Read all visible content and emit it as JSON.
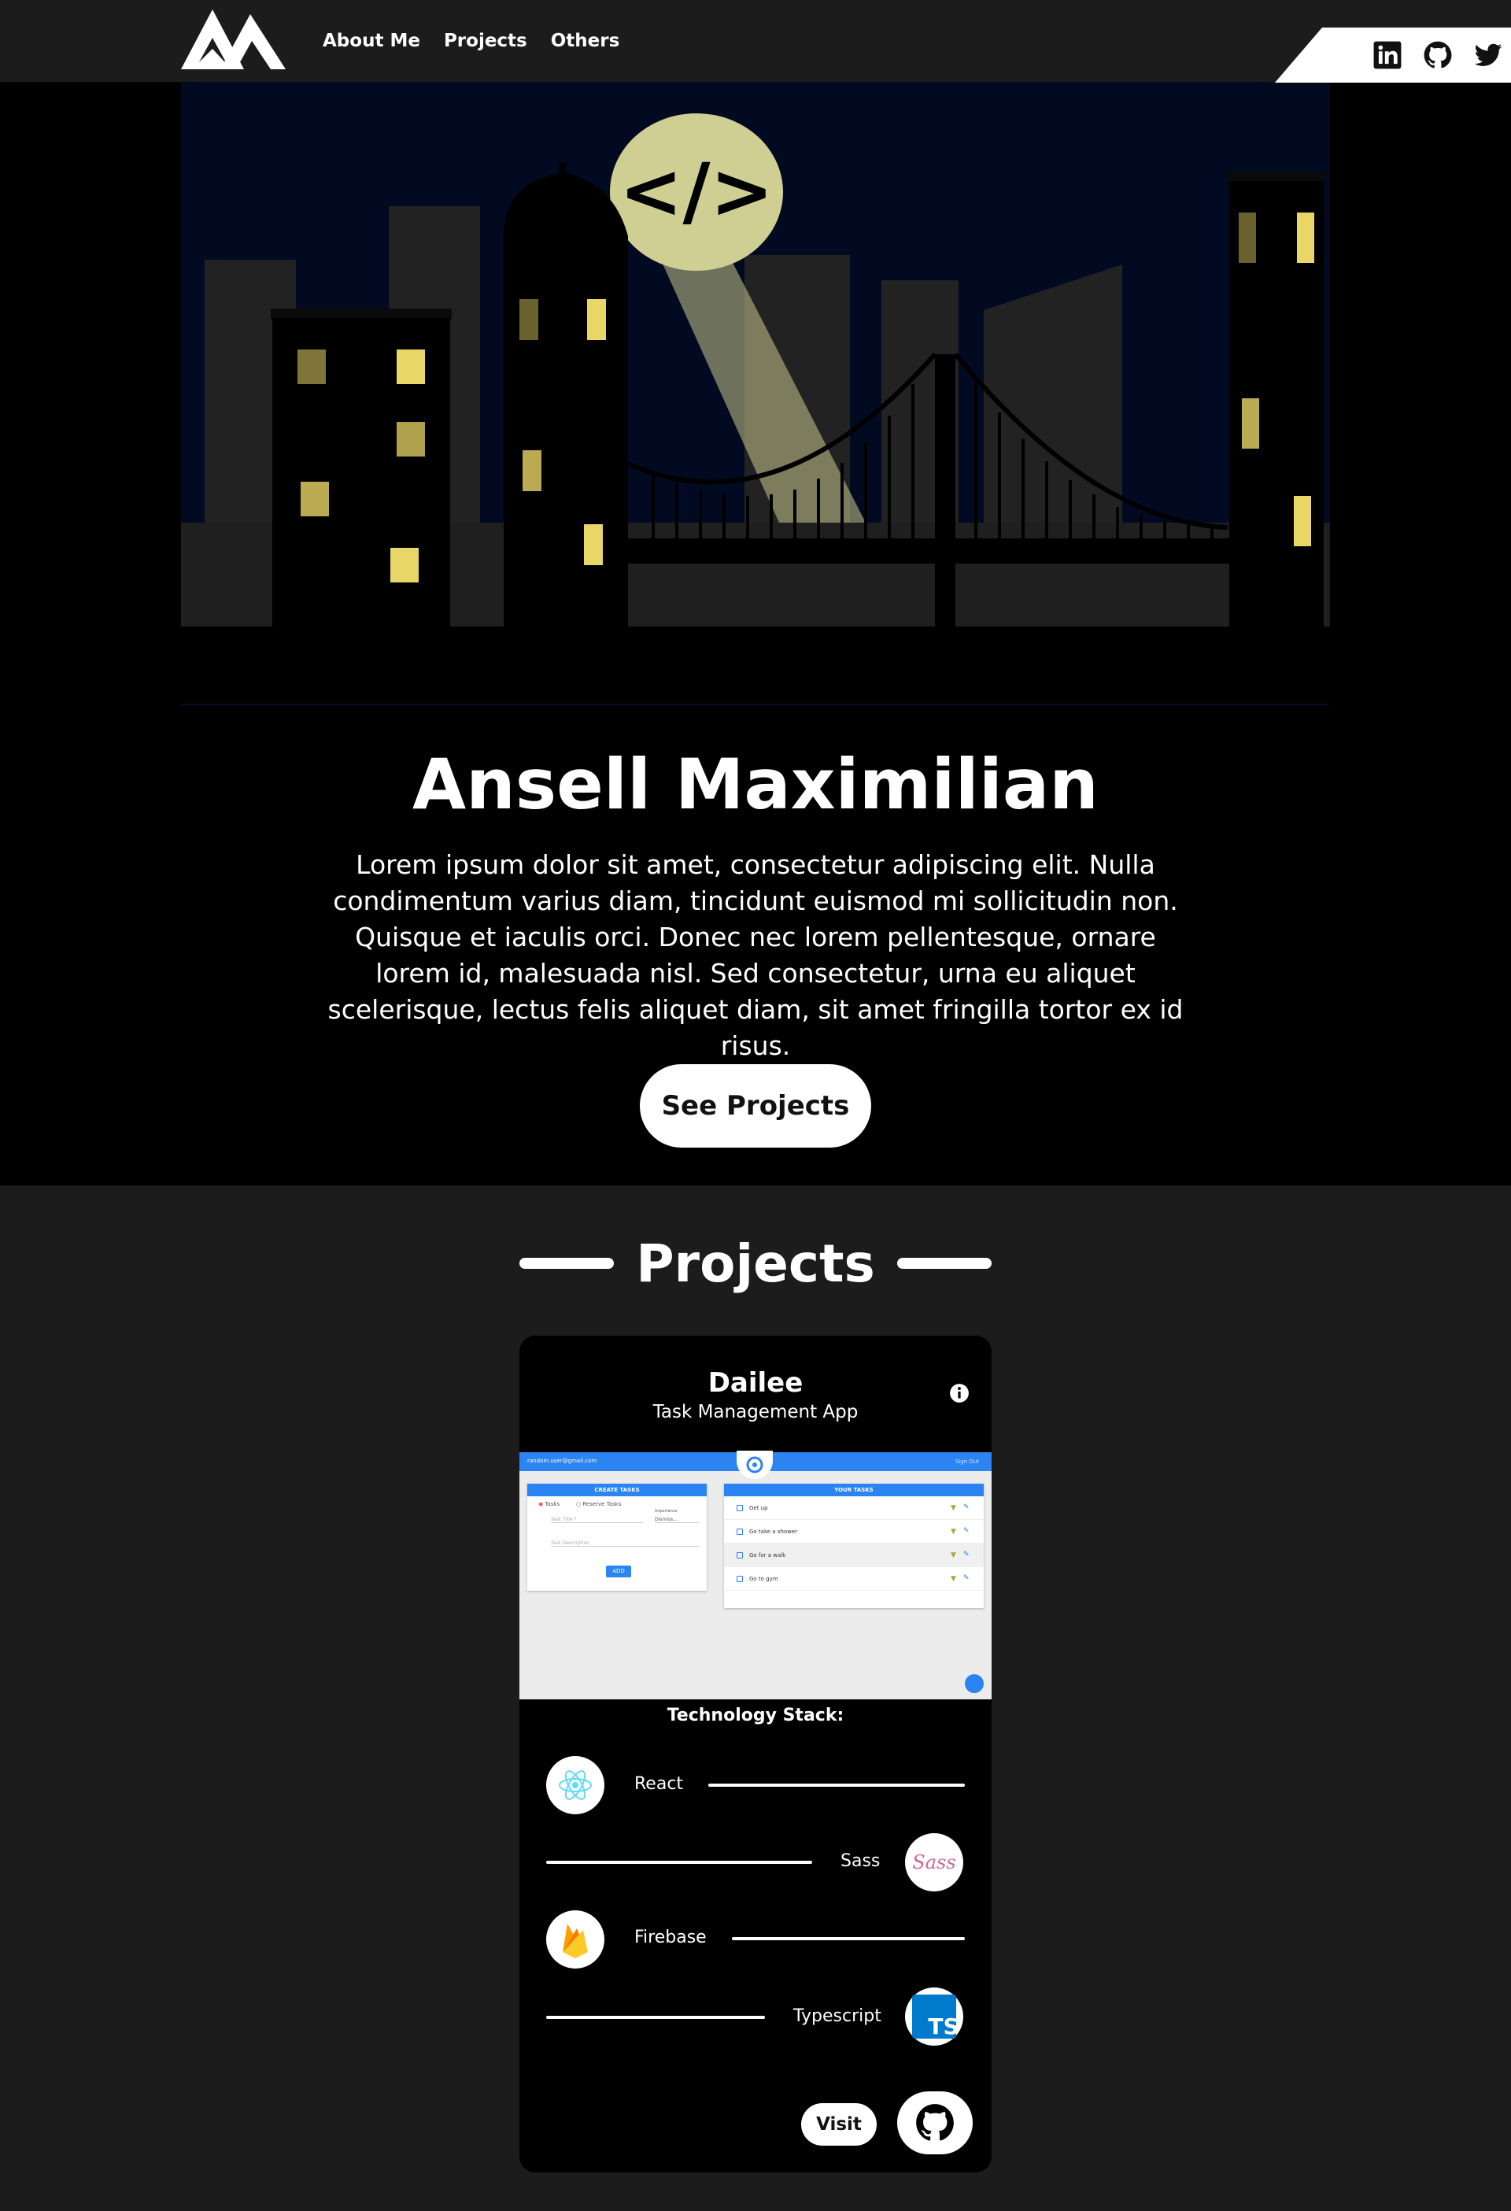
{
  "nav": {
    "logo": "logo",
    "links": [
      "About Me",
      "Projects",
      "Others"
    ],
    "social_icons": [
      "linkedin-icon",
      "github-icon",
      "twitter-icon"
    ]
  },
  "hero": {
    "title": "Ansell Maximilian",
    "text": "Lorem ipsum dolor sit amet, consectetur adipiscing elit. Nulla condimentum varius diam, tincidunt euismod mi sollicitudin non. Quisque et iaculis orci. Donec nec lorem pellentesque, ornare lorem id, malesuada nisl. Sed consectetur, urna eu aliquet scelerisque, lectus felis aliquet diam, sit amet fringilla tortor ex id risus.",
    "button": "See Projects",
    "signal_text": "</>"
  },
  "projects": {
    "heading": "Projects",
    "card": {
      "title": "Dailee",
      "subtitle": "Task Management App",
      "screenshot": {
        "email": "random.user@gmail.com",
        "signout": "Sign Out",
        "create_header": "CREATE TASKS",
        "tasks_header": "YOUR TASKS",
        "radio_tasks": "Tasks",
        "radio_reserve": "Reserve Tasks",
        "importance_label": "Importance",
        "importance_value": "Dismiss...",
        "title_placeholder": "Task Title *",
        "desc_placeholder": "Task Description",
        "add_label": "ADD",
        "tasks": [
          "Get up",
          "Go take a shower",
          "Go for a walk",
          "Go to gym"
        ]
      },
      "stack_title": "Technology Stack:",
      "stack": [
        "React",
        "Sass",
        "Firebase",
        "Typescript"
      ],
      "visit": "Visit"
    }
  },
  "colors": {
    "accent_blue": "#2b84f1",
    "night_sky": "#020a22",
    "window_yellow": "#ffe066",
    "spotlight": "#cfcf93"
  }
}
